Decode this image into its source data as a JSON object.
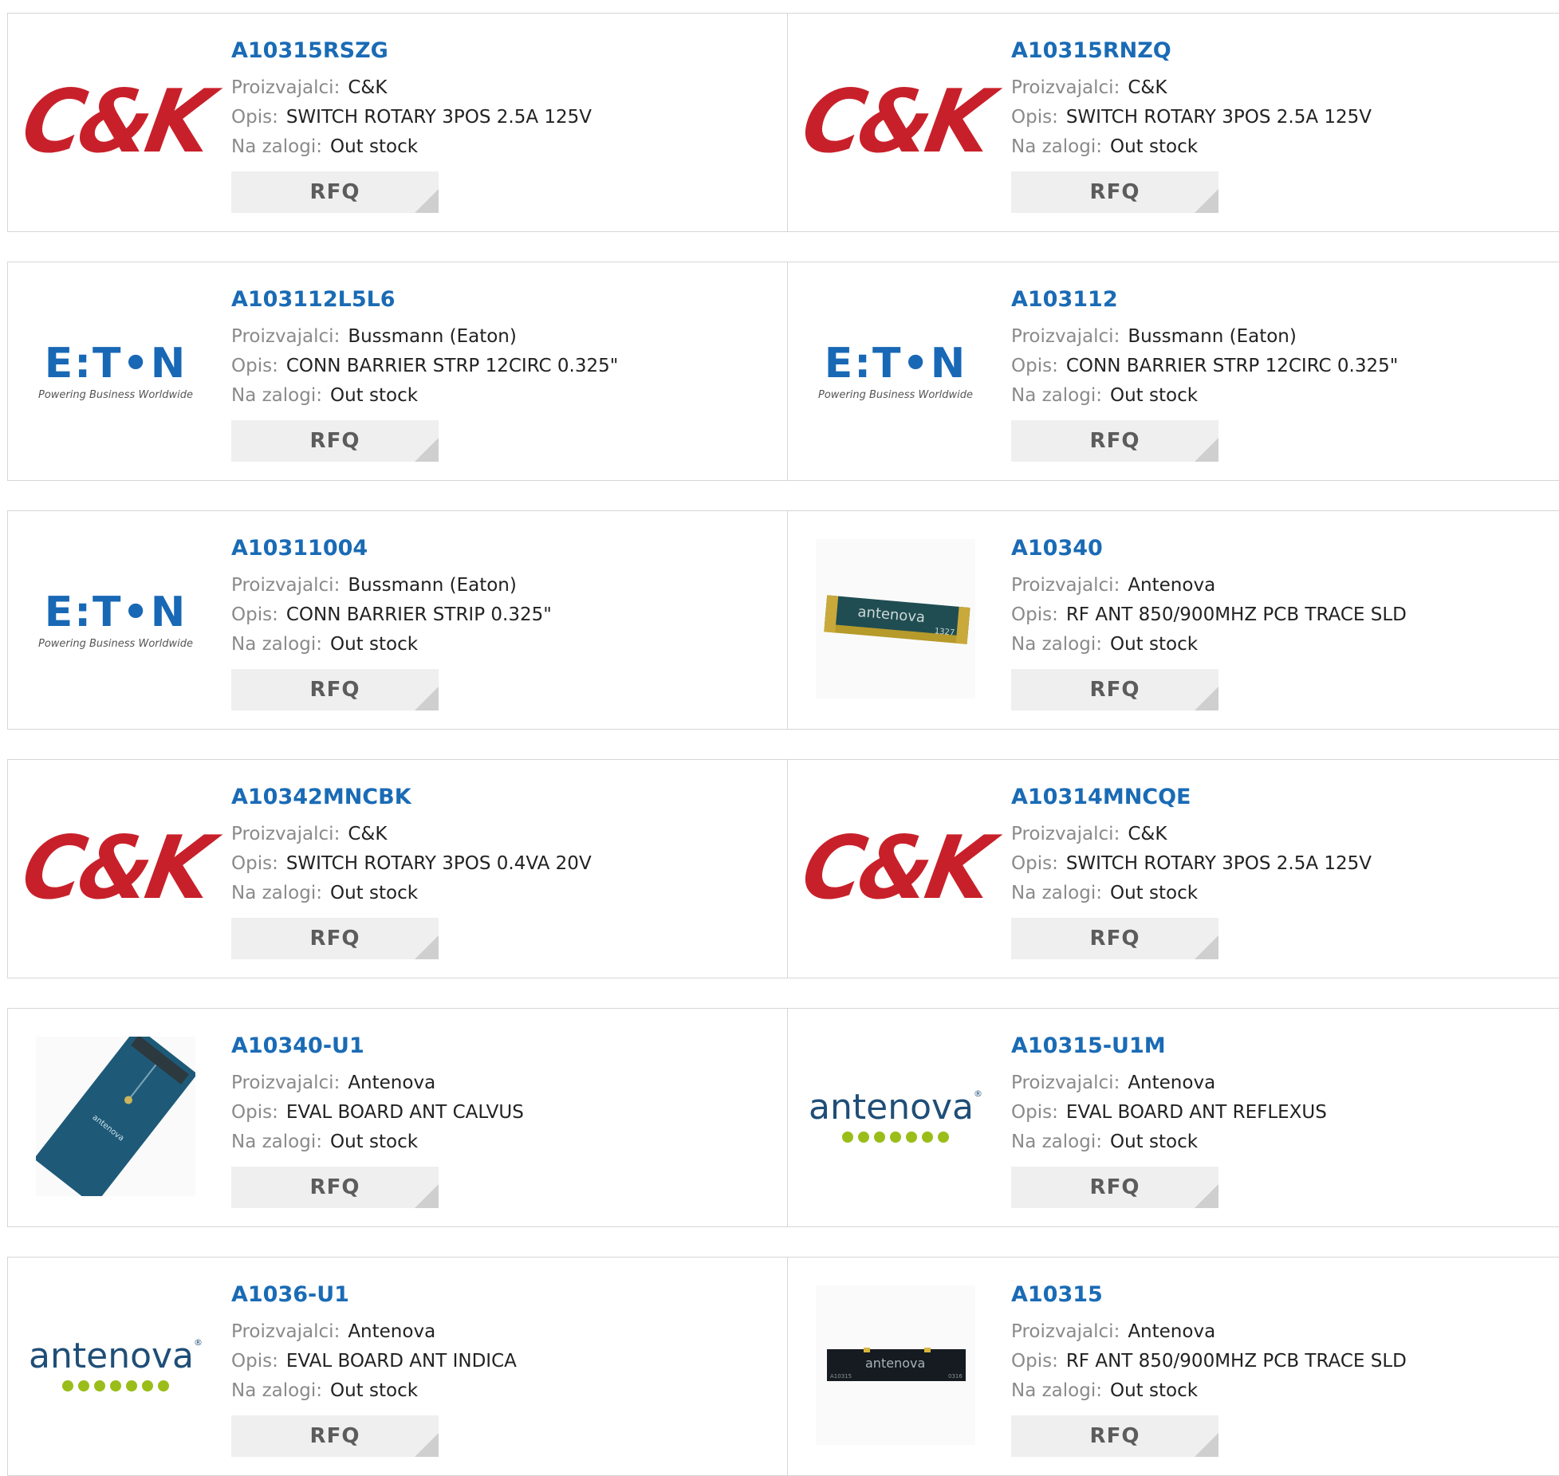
{
  "labels": {
    "manufacturer": "Proizvajalci:",
    "description": "Opis:",
    "stock": "Na zalogi:",
    "rfq": "RFQ"
  },
  "products": [
    {
      "part": "A10315RSZG",
      "manufacturer": "C&K",
      "description": "SWITCH ROTARY 3POS 2.5A 125V",
      "stock": "Out stock",
      "logo": "ck-logo"
    },
    {
      "part": "A10315RNZQ",
      "manufacturer": "C&K",
      "description": "SWITCH ROTARY 3POS 2.5A 125V",
      "stock": "Out stock",
      "logo": "ck-logo"
    },
    {
      "part": "A103112L5L6",
      "manufacturer": "Bussmann (Eaton)",
      "description": "CONN BARRIER STRP 12CIRC 0.325\"",
      "stock": "Out stock",
      "logo": "eaton-logo"
    },
    {
      "part": "A103112",
      "manufacturer": "Bussmann (Eaton)",
      "description": "CONN BARRIER STRP 12CIRC 0.325\"",
      "stock": "Out stock",
      "logo": "eaton-logo"
    },
    {
      "part": "A10311004",
      "manufacturer": "Bussmann (Eaton)",
      "description": "CONN BARRIER STRIP 0.325\"",
      "stock": "Out stock",
      "logo": "eaton-logo"
    },
    {
      "part": "A10340",
      "manufacturer": "Antenova",
      "description": "RF ANT 850/900MHZ PCB TRACE SLD",
      "stock": "Out stock",
      "logo": "antenna-chip-photo"
    },
    {
      "part": "A10342MNCBK",
      "manufacturer": "C&K",
      "description": "SWITCH ROTARY 3POS 0.4VA 20V",
      "stock": "Out stock",
      "logo": "ck-logo"
    },
    {
      "part": "A10314MNCQE",
      "manufacturer": "C&K",
      "description": "SWITCH ROTARY 3POS 2.5A 125V",
      "stock": "Out stock",
      "logo": "ck-logo"
    },
    {
      "part": "A10340-U1",
      "manufacturer": "Antenova",
      "description": "EVAL BOARD ANT CALVUS",
      "stock": "Out stock",
      "logo": "eval-board-photo"
    },
    {
      "part": "A10315-U1M",
      "manufacturer": "Antenova",
      "description": "EVAL BOARD ANT REFLEXUS",
      "stock": "Out stock",
      "logo": "antenova-logo"
    },
    {
      "part": "A1036-U1",
      "manufacturer": "Antenova",
      "description": "EVAL BOARD ANT INDICA",
      "stock": "Out stock",
      "logo": "antenova-logo"
    },
    {
      "part": "A10315",
      "manufacturer": "Antenova",
      "description": "RF ANT 850/900MHZ PCB TRACE SLD",
      "stock": "Out stock",
      "logo": "antenna-chip-black-photo"
    }
  ],
  "logo_text": {
    "ck": "C&K",
    "eaton": "E:T•N",
    "eaton_tag": "Powering Business Worldwide",
    "antenova": "antenova",
    "chip_label": "antenova",
    "chip_code": "1327",
    "chip_black_left": "A10315",
    "chip_black_right": "0316"
  },
  "colors": {
    "part_link": "#1a6bb5",
    "label": "#8a8a8a",
    "value": "#222222",
    "rfq_bg": "#efefef",
    "ck_red": "#c8202a",
    "eaton_blue": "#1868b5",
    "antenova_green": "#9bbd1a"
  }
}
